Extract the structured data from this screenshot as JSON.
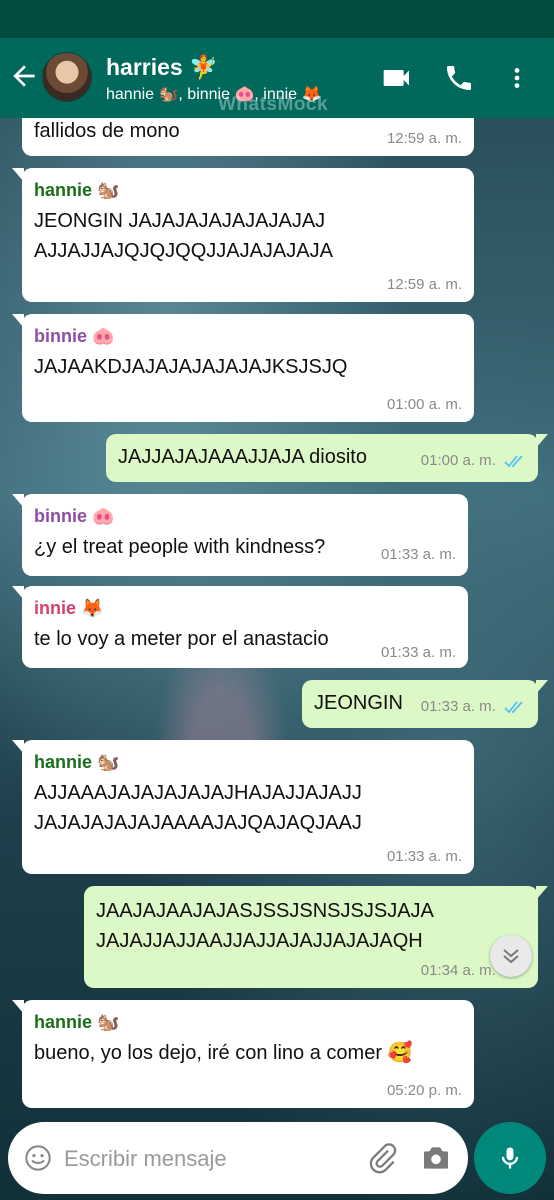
{
  "header": {
    "title": "harries 🧚",
    "subtitle": "hannie 🐿️, binnie 🐽, innie 🦊",
    "watermark": "WhatsMock",
    "back_icon": "arrow-left-icon",
    "call_icons": [
      "video-call-icon",
      "phone-icon",
      "more-vert-icon"
    ]
  },
  "colors": {
    "header": "#00695c",
    "statusbar": "#004d40",
    "incoming_bubble": "#ffffff",
    "outgoing_bubble": "#dcf8c6",
    "hannie": "#1b6e1b",
    "binnie": "#8e4fa0",
    "innie": "#d2436a",
    "read_ticks": "#4fc3f7"
  },
  "messages": [
    {
      "dir": "in",
      "sender": "",
      "lines": [
        "fallidos de mono"
      ],
      "time": "12:59 a. m."
    },
    {
      "dir": "in",
      "sender": "hannie 🐿️",
      "lines": [
        "JEONGIN JAJAJAJAJAJAJAJAJ",
        "AJJAJJAJQJQJQQJJAJAJAJAJA"
      ],
      "time": "12:59 a. m."
    },
    {
      "dir": "in",
      "sender": "binnie 🐽",
      "lines": [
        "JAJAAKDJAJAJAJAJAJAJKSJSJQ"
      ],
      "time": "01:00 a. m."
    },
    {
      "dir": "out",
      "sender": "",
      "lines": [
        "JAJJAJAJAAAJJAJA diosito"
      ],
      "time": "01:00 a. m.",
      "read": true
    },
    {
      "dir": "in",
      "sender": "binnie 🐽",
      "lines": [
        "¿y el treat people with kindness?"
      ],
      "time": "01:33 a. m."
    },
    {
      "dir": "in",
      "sender": "innie 🦊",
      "lines": [
        "te lo voy a meter por el anastacio"
      ],
      "time": "01:33 a. m."
    },
    {
      "dir": "out",
      "sender": "",
      "lines": [
        "JEONGIN"
      ],
      "time": "01:33 a. m.",
      "read": true
    },
    {
      "dir": "in",
      "sender": "hannie 🐿️",
      "lines": [
        "AJJAAAJAJAJAJAJAJHAJAJJAJAJJ",
        "JAJAJAJAJAJAAAAJAJQAJAQJAAJ"
      ],
      "time": "01:33 a. m."
    },
    {
      "dir": "out",
      "sender": "",
      "lines": [
        "JAAJAJAAJAJASJSSJSNSJSJSJAJA",
        "JAJAJJAJJAAJJAJJAJAJJAJAJAQH"
      ],
      "time": "01:34 a. m.",
      "read": true
    },
    {
      "dir": "in",
      "sender": "hannie 🐿️",
      "lines": [
        "bueno, yo los dejo, iré con lino a comer 🥰"
      ],
      "time": "05:20 p. m."
    }
  ],
  "composer": {
    "placeholder": "Escribir mensaje",
    "icons": [
      "emoji-icon",
      "attach-icon",
      "camera-icon",
      "mic-icon"
    ]
  },
  "scroll_button_icon": "double-chevron-down-icon"
}
